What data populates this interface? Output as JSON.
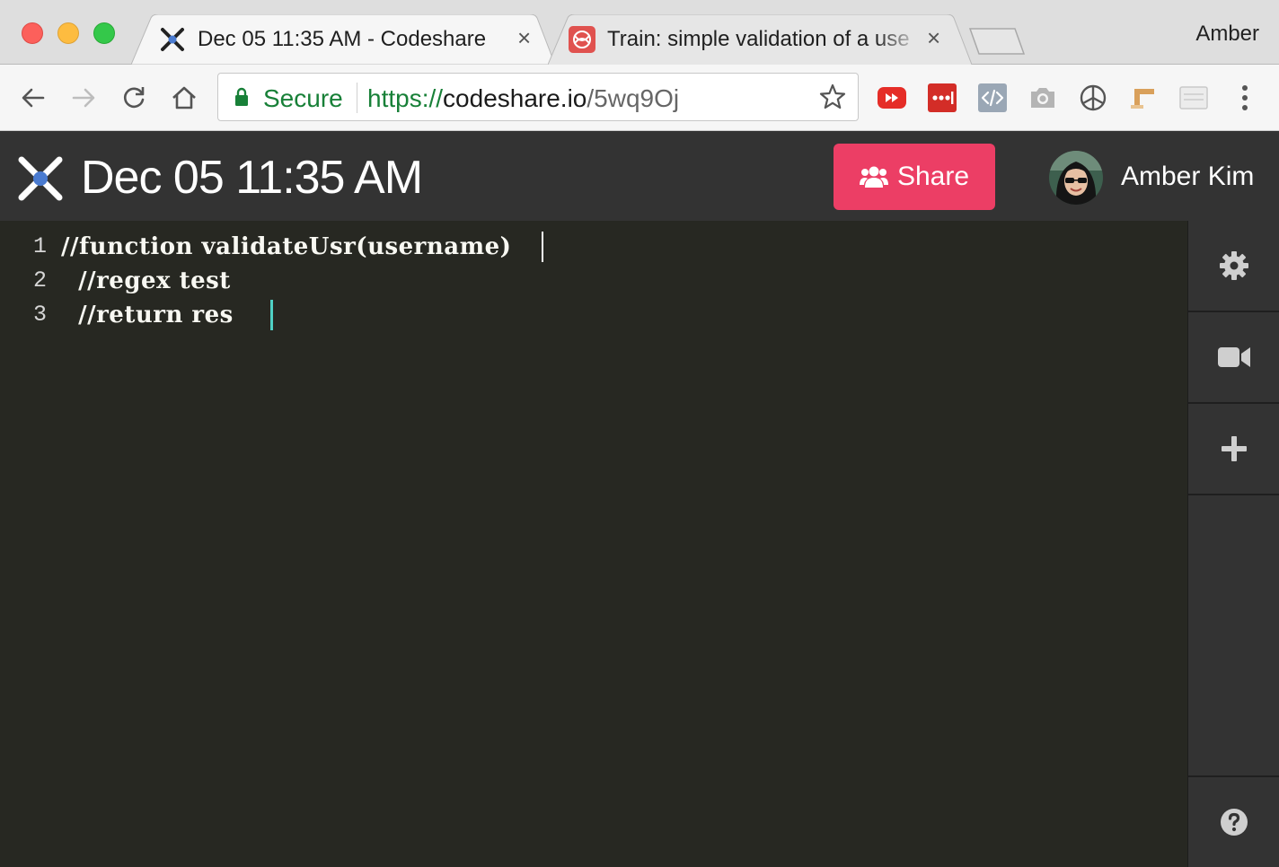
{
  "browser": {
    "tabs": [
      {
        "title": "Dec 05 11:35 AM - Codeshare",
        "favicon": "codeshare-icon",
        "active": true
      },
      {
        "title": "Train: simple validation of a use",
        "favicon": "codewars-icon",
        "active": false
      }
    ],
    "profile_name": "Amber",
    "secure_label": "Secure",
    "url": {
      "scheme": "https://",
      "host": "codeshare.io",
      "path": "/5wq9Oj"
    },
    "extensions": [
      "youtube-icon",
      "lastpass-icon",
      "code-viewer-icon",
      "camera-icon",
      "openai-icon",
      "gitlab-pipe-icon",
      "window-icon"
    ]
  },
  "app": {
    "title": "Dec 05 11:35 AM",
    "share_label": "Share",
    "user_name": "Amber Kim"
  },
  "editor": {
    "lines": [
      {
        "number": "1",
        "code": "//function validateUsr(username)"
      },
      {
        "number": "2",
        "code": "  //regex test"
      },
      {
        "number": "3",
        "code": "  //return res"
      }
    ]
  },
  "sidebar": {
    "buttons": [
      "settings-icon",
      "video-icon",
      "plus-icon",
      "help-icon"
    ]
  },
  "colors": {
    "share_button": "#ec3e65",
    "header_bg": "#333333",
    "editor_bg": "#272822",
    "secure_green": "#188038"
  }
}
